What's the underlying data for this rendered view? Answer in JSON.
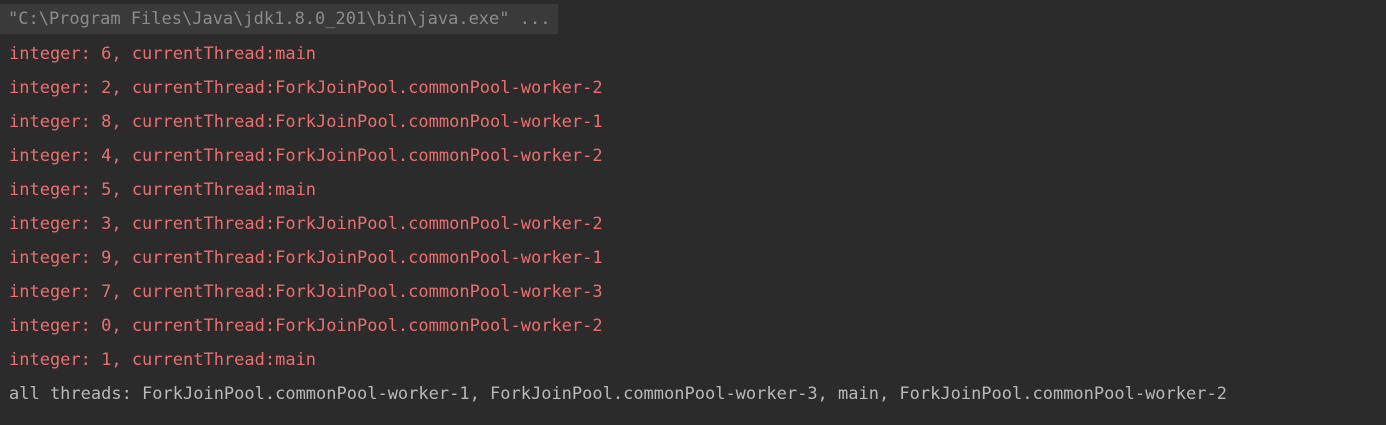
{
  "console": {
    "command": "\"C:\\Program Files\\Java\\jdk1.8.0_201\\bin\\java.exe\" ...",
    "lines": [
      "integer: 6, currentThread:main",
      "integer: 2, currentThread:ForkJoinPool.commonPool-worker-2",
      "integer: 8, currentThread:ForkJoinPool.commonPool-worker-1",
      "integer: 4, currentThread:ForkJoinPool.commonPool-worker-2",
      "integer: 5, currentThread:main",
      "integer: 3, currentThread:ForkJoinPool.commonPool-worker-2",
      "integer: 9, currentThread:ForkJoinPool.commonPool-worker-1",
      "integer: 7, currentThread:ForkJoinPool.commonPool-worker-3",
      "integer: 0, currentThread:ForkJoinPool.commonPool-worker-2",
      "integer: 1, currentThread:main"
    ],
    "summary": "all threads: ForkJoinPool.commonPool-worker-1, ForkJoinPool.commonPool-worker-3, main, ForkJoinPool.commonPool-worker-2"
  },
  "colors": {
    "background": "#2b2b2b",
    "stderr_text": "#ec6f6f",
    "stdout_text": "#b9b9b9",
    "command_text": "#8c8c8c"
  }
}
